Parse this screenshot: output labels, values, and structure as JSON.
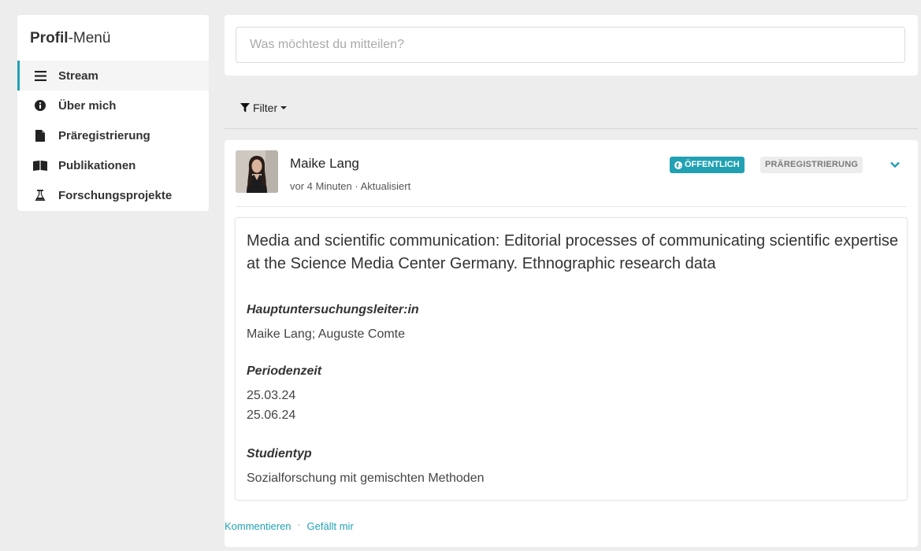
{
  "sidebar": {
    "title_bold": "Profil",
    "title_rest": "-Menü",
    "items": [
      {
        "label": "Stream",
        "icon": "list-icon",
        "active": true
      },
      {
        "label": "Über mich",
        "icon": "info-icon"
      },
      {
        "label": "Präregistrierung",
        "icon": "file-icon"
      },
      {
        "label": "Publikationen",
        "icon": "book-icon"
      },
      {
        "label": "Forschungsprojekte",
        "icon": "flask-icon"
      }
    ]
  },
  "composer": {
    "placeholder": "Was möchtest du mitteilen?"
  },
  "filter": {
    "label": "Filter"
  },
  "post": {
    "author": "Maike Lang",
    "meta": "vor 4 Minuten · Aktualisiert",
    "badge_public": "ÖFFENTLICH",
    "badge_type": "PRÄREGISTRIERUNG",
    "title": "Media and scientific communication: Editorial processes of communicating scientific expertise at the Science Media Center Germany. Ethnographic research data",
    "sections": [
      {
        "label": "Hauptuntersuchungsleiter:in",
        "values": [
          "Maike Lang; Auguste Comte"
        ]
      },
      {
        "label": "Periodenzeit",
        "values": [
          "25.03.24",
          "25.06.24"
        ]
      },
      {
        "label": "Studientyp",
        "values": [
          "Sozialforschung mit gemischten Methoden"
        ]
      }
    ],
    "actions": {
      "comment": "Kommentieren",
      "separator": "·",
      "like": "Gefällt mir"
    }
  },
  "colors": {
    "accent": "#21a1b3",
    "background": "#ededed"
  }
}
